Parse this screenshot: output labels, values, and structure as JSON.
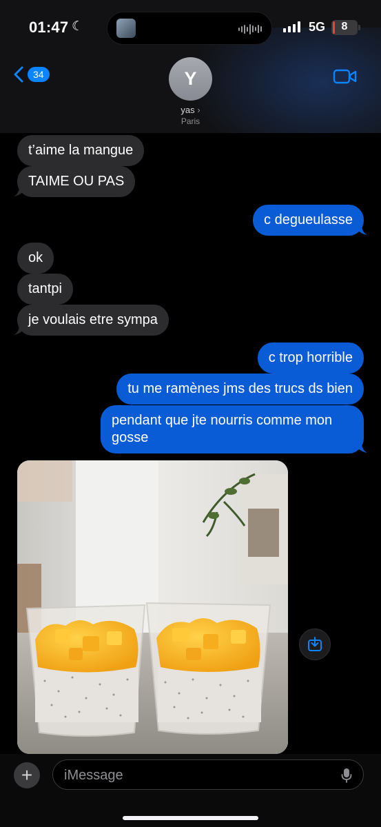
{
  "status": {
    "time": "01:47",
    "network": "5G",
    "battery": "8",
    "battery_level": 0.08
  },
  "header": {
    "back_badge": "34",
    "avatar_initial": "Y",
    "contact_name": "yas",
    "contact_location": "Paris"
  },
  "messages": [
    {
      "direction": "received",
      "text": "t’aime la mangue"
    },
    {
      "direction": "received",
      "text": "TAIME OU PAS"
    },
    {
      "direction": "sent",
      "text": "c degueulasse"
    },
    {
      "direction": "received",
      "text": "ok"
    },
    {
      "direction": "received",
      "text": "tantpi"
    },
    {
      "direction": "received",
      "text": "je voulais etre sympa"
    },
    {
      "direction": "sent",
      "text": "c trop horrible"
    },
    {
      "direction": "sent",
      "text": "tu me ramènes jms des trucs ds bien"
    },
    {
      "direction": "sent",
      "text": "pendant que jte nourris comme mon gosse"
    },
    {
      "direction": "received",
      "type": "photo",
      "subject": "two glasses of chia pudding topped with diced mango"
    }
  ],
  "composer": {
    "placeholder": "iMessage"
  },
  "colors": {
    "sent_bubble": "#0a5bd6",
    "received_bubble": "#2c2c2e",
    "accent": "#0a84ff"
  },
  "icons": [
    "moon-icon",
    "signal-icon",
    "battery-icon",
    "back-chevron-icon",
    "video-call-icon",
    "save-to-photos-icon",
    "plus-icon",
    "microphone-icon"
  ]
}
